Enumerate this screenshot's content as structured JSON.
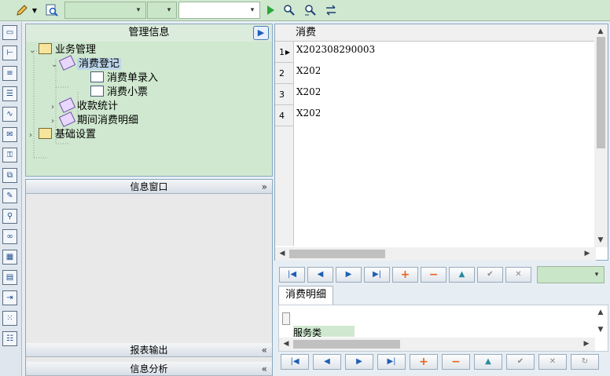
{
  "toolbar": {
    "icons": [
      "pencil-icon",
      "dropdown-arrow-icon",
      "search-doc-icon",
      "play-icon",
      "find-icon",
      "find-next-icon",
      "refresh-link-icon"
    ],
    "combo1_value": "",
    "combo2_value": "",
    "combo3_value": ""
  },
  "sidebar_icons": [
    "window-icon",
    "tree-structure-icon",
    "form-icon",
    "document-icon",
    "chart-icon",
    "mail-icon",
    "key-list-icon",
    "copy-icon",
    "edit-form-icon",
    "user-search-icon",
    "link-icon",
    "calendar-icon",
    "report-icon",
    "export-icon",
    "grid-icon",
    "list-icon"
  ],
  "mgmt": {
    "title": "管理信息",
    "tree": [
      {
        "label": "业务管理",
        "level": 0,
        "expanded": true
      },
      {
        "label": "消费登记",
        "level": 1,
        "expanded": true,
        "selected": true
      },
      {
        "label": "消费单录入",
        "level": 2
      },
      {
        "label": "消费小票",
        "level": 2
      },
      {
        "label": "收款统计",
        "level": 1
      },
      {
        "label": "期间消费明细",
        "level": 1
      },
      {
        "label": "基础设置",
        "level": 0
      }
    ]
  },
  "info_panel": {
    "title": "信息窗口",
    "report_title": "报表输出",
    "analysis_title": "信息分析"
  },
  "grid": {
    "column_header": "消费",
    "rows": [
      {
        "num": "1",
        "value": "X202308290003",
        "current": true
      },
      {
        "num": "2",
        "value": "X202"
      },
      {
        "num": "3",
        "value": "X202"
      },
      {
        "num": "4",
        "value": "X202"
      }
    ]
  },
  "detail": {
    "tab_label": "消费明细",
    "row_text": "服务类"
  },
  "colors": {
    "accent_green": "#cfe8cf",
    "nav_blue": "#1f5fb5",
    "nav_orange": "#e8641b"
  }
}
